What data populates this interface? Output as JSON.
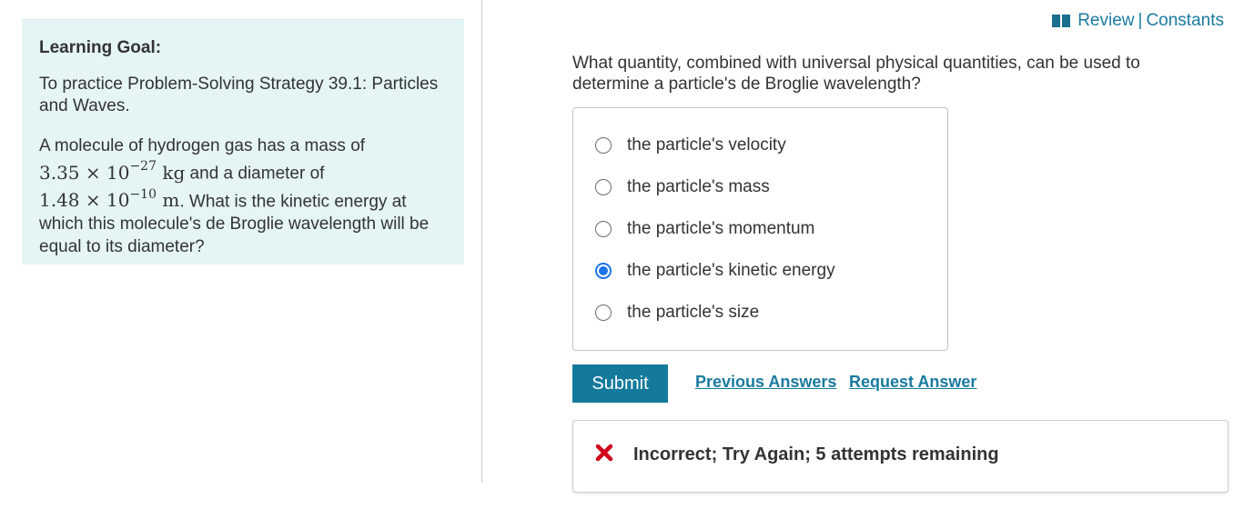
{
  "learning_goal": {
    "title": "Learning Goal:",
    "subtitle": "To practice Problem-Solving Strategy 39.1: Particles and Waves.",
    "problem": {
      "text_1": "A molecule of hydrogen gas has a mass of",
      "mass_value": "3.35 × 10",
      "mass_exponent": "−27",
      "mass_unit": "kg",
      "text_2": " and a diameter of",
      "diameter_value": "1.48 × 10",
      "diameter_exponent": "−10",
      "diameter_unit": "m",
      "text_3": ". What is the kinetic energy at which this molecule's de Broglie wavelength will be equal to its diameter?"
    }
  },
  "header": {
    "review_label": "Review",
    "separator": "|",
    "constants_label": "Constants"
  },
  "question": {
    "text": "What quantity, combined with universal physical quantities, can be used to determine a particle's de Broglie wavelength?"
  },
  "options": [
    {
      "label": "the particle's velocity",
      "checked": false
    },
    {
      "label": "the particle's mass",
      "checked": false
    },
    {
      "label": "the particle's momentum",
      "checked": false
    },
    {
      "label": "the particle's kinetic energy",
      "checked": true
    },
    {
      "label": "the particle's size",
      "checked": false
    }
  ],
  "actions": {
    "submit_label": "Submit",
    "previous_answers_label": "Previous Answers",
    "request_answer_label": "Request Answer"
  },
  "feedback": {
    "text": "Incorrect; Try Again; 5 attempts remaining",
    "icon": "x-icon"
  },
  "colors": {
    "accent": "#137a9c",
    "link": "#1a7aa0",
    "goal_background": "#e5f5f6",
    "radio_selected": "#1a73e8",
    "error": "#d0021b"
  }
}
